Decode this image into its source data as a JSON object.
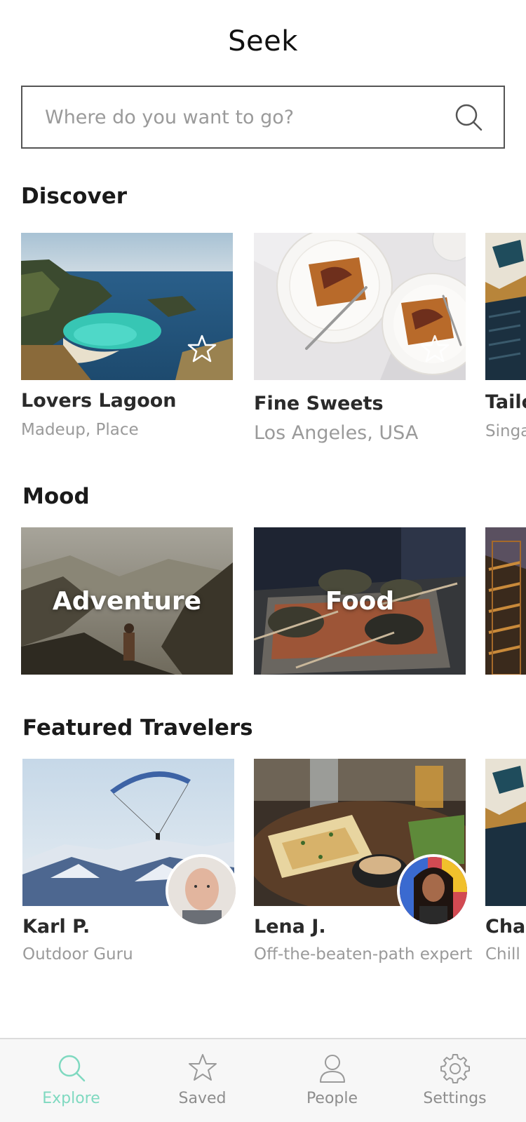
{
  "app": {
    "title": "Seek"
  },
  "search": {
    "placeholder": "Where do you want to go?"
  },
  "discover": {
    "title": "Discover",
    "cards": [
      {
        "title": "Lovers Lagoon",
        "subtitle": "Madeup, Place"
      },
      {
        "title": "Fine Sweets",
        "subtitle": "Los Angeles, USA"
      },
      {
        "title": "Tailo",
        "subtitle": "Singa"
      }
    ]
  },
  "mood": {
    "title": "Mood",
    "cards": [
      {
        "label": "Adventure"
      },
      {
        "label": "Food"
      }
    ]
  },
  "travelers": {
    "title": "Featured Travelers",
    "cards": [
      {
        "name": "Karl P.",
        "tagline": "Outdoor Guru"
      },
      {
        "name": "Lena J.",
        "tagline": "Off-the-beaten-path expert"
      },
      {
        "name": "Char",
        "tagline": "Chill a"
      }
    ]
  },
  "tabbar": {
    "items": [
      {
        "label": "Explore",
        "icon": "search-icon",
        "active": true
      },
      {
        "label": "Saved",
        "icon": "star-icon",
        "active": false
      },
      {
        "label": "People",
        "icon": "person-icon",
        "active": false
      },
      {
        "label": "Settings",
        "icon": "gear-icon",
        "active": false
      }
    ]
  },
  "colors": {
    "accent": "#7fd9c0",
    "text_muted": "#9a9a9a"
  }
}
